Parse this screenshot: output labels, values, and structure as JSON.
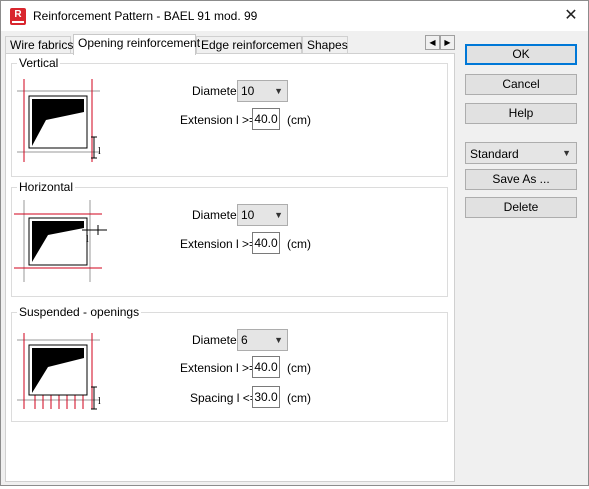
{
  "window": {
    "title": "Reinforcement Pattern - BAEL 91 mod. 99",
    "icon": "revit-r-icon",
    "close": "✕"
  },
  "tabs": [
    {
      "label": "Wire fabrics",
      "active": false
    },
    {
      "label": "Opening reinforcement",
      "active": true
    },
    {
      "label": "Edge reinforcement",
      "active": false
    },
    {
      "label": "Shapes",
      "active": false
    }
  ],
  "tab_scroll": {
    "left": "◀",
    "right": "▶"
  },
  "groups": {
    "vertical": {
      "title": "Vertical",
      "diameter_label": "Diameter",
      "diameter_value": "10",
      "extension_label": "Extension l >=",
      "extension_value": "40.0",
      "unit": "(cm)"
    },
    "horizontal": {
      "title": "Horizontal",
      "diameter_label": "Diameter",
      "diameter_value": "10",
      "extension_label": "Extension l >=",
      "extension_value": "40.0",
      "unit": "(cm)"
    },
    "suspended": {
      "title": "Suspended - openings",
      "diameter_label": "Diameter",
      "diameter_value": "6",
      "extension_label": "Extension l >=",
      "extension_value": "40.0",
      "unit": "(cm)",
      "spacing_label": "Spacing l <=",
      "spacing_value": "30.0",
      "spacing_unit": "(cm)"
    }
  },
  "buttons": {
    "ok": "OK",
    "cancel": "Cancel",
    "help": "Help",
    "save_as": "Save As ...",
    "delete": "Delete"
  },
  "standard_select": {
    "value": "Standard"
  },
  "diagram_marker": "l",
  "combo_arrow": "▼",
  "colors": {
    "rebar": "#d0021b",
    "accent": "#0078d7"
  }
}
